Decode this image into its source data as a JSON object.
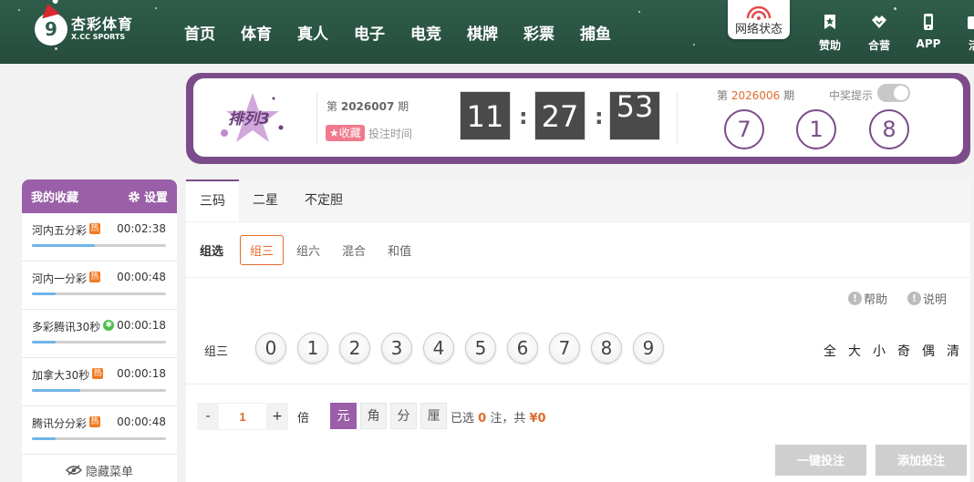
{
  "header": {
    "logo_cn": "杏彩体育",
    "logo_en": "X.CC SPORTS",
    "logo_mark": "9",
    "nav": [
      "首页",
      "体育",
      "真人",
      "电子",
      "电竞",
      "棋牌",
      "彩票",
      "捕鱼"
    ],
    "network_status": "网络状态",
    "icons": [
      {
        "label": "赞助",
        "icon": "sponsor-icon"
      },
      {
        "label": "合营",
        "icon": "handshake-icon"
      },
      {
        "label": "APP",
        "icon": "phone-icon"
      },
      {
        "label": "活",
        "icon": "activity-icon"
      }
    ],
    "colors": {
      "bg": "#2f5d4a",
      "accent": "#d9282f"
    }
  },
  "banner": {
    "logo_text": "排列3",
    "current_period_prefix": "第",
    "current_period": "2026007",
    "current_period_suffix": "期",
    "fav_label": "收藏",
    "deadline_label": "投注时间",
    "timer": {
      "h": "11",
      "m": "27",
      "s": "53"
    },
    "last_period_prefix": "第",
    "last_period": "2026006",
    "last_period_suffix": "期",
    "win_tip_label": "中奖提示",
    "win_tip_on": false,
    "balls": [
      "7",
      "1",
      "8"
    ],
    "colors": {
      "frame": "#7c4c8a",
      "period": "#e06b2a"
    }
  },
  "sidebar": {
    "title": "我的收藏",
    "settings": "设置",
    "items": [
      {
        "name": "河内五分彩",
        "badge": "热",
        "badge_type": "hot",
        "time": "00:02:38",
        "progress": 0.47
      },
      {
        "name": "河内一分彩",
        "badge": "热",
        "badge_type": "hot",
        "time": "00:00:48",
        "progress": 0.18
      },
      {
        "name": "多彩腾讯30秒",
        "badge": "✱",
        "badge_type": "new",
        "time": "00:00:18",
        "progress": 0.18
      },
      {
        "name": "加拿大30秒",
        "badge": "热",
        "badge_type": "hot",
        "time": "00:00:18",
        "progress": 0.36
      },
      {
        "name": "腾讯分分彩",
        "badge": "热",
        "badge_type": "hot",
        "time": "00:00:48",
        "progress": 0.18
      }
    ],
    "hide_menu": "隐藏菜单"
  },
  "main": {
    "tabs": [
      "三码",
      "二星",
      "不定胆"
    ],
    "subtab_label": "组选",
    "subtabs": [
      "组三",
      "组六",
      "混合",
      "和值"
    ],
    "help": "帮助",
    "explain": "说明",
    "number_row_label": "组三",
    "numbers": [
      "0",
      "1",
      "2",
      "3",
      "4",
      "5",
      "6",
      "7",
      "8",
      "9"
    ],
    "quick": [
      "全",
      "大",
      "小",
      "奇",
      "偶",
      "清"
    ],
    "multiplier": {
      "minus": "-",
      "value": "1",
      "plus": "+",
      "unit": "倍"
    },
    "units": [
      "元",
      "角",
      "分",
      "厘"
    ],
    "summary": {
      "prefix": "已选",
      "count": "0",
      "mid": "注，共",
      "amount": "¥0"
    },
    "btn_quick_bet": "一键投注",
    "btn_add_bet": "添加投注"
  }
}
